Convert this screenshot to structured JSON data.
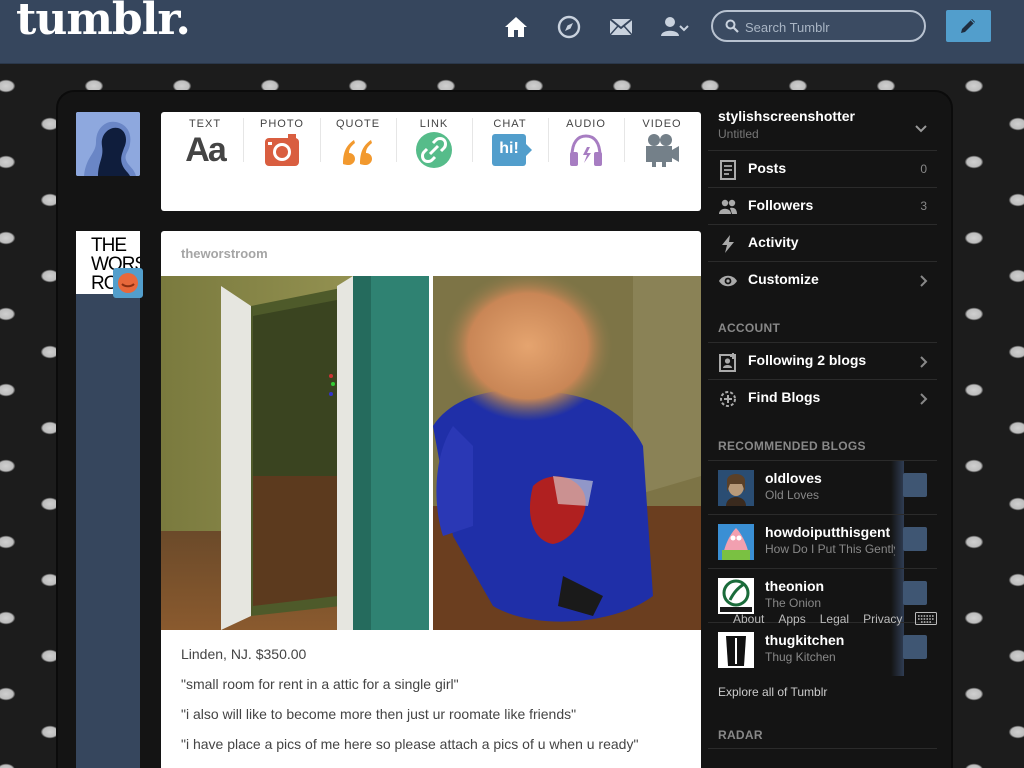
{
  "header": {
    "logo": "tumblr.",
    "nav_icons": [
      "home-icon",
      "explore-compass-icon",
      "inbox-mail-icon",
      "account-person-icon"
    ],
    "search_placeholder": "Search Tumblr",
    "compose_icon": "pencil-icon",
    "colors": {
      "bar": "#36465d",
      "accent": "#529ecc"
    }
  },
  "post_types": [
    {
      "label": "TEXT",
      "icon": "text-aa-icon",
      "glyph": "Aa",
      "color": "#444444"
    },
    {
      "label": "PHOTO",
      "icon": "camera-icon",
      "color": "#d95e40"
    },
    {
      "label": "QUOTE",
      "icon": "quote-icon",
      "color": "#f2992e"
    },
    {
      "label": "LINK",
      "icon": "link-icon",
      "color": "#56bc8a"
    },
    {
      "label": "CHAT",
      "icon": "chat-bubble-icon",
      "glyph": "hi!",
      "color": "#529ecc"
    },
    {
      "label": "AUDIO",
      "icon": "headphones-icon",
      "color": "#a77dc2"
    },
    {
      "label": "VIDEO",
      "icon": "video-camera-icon",
      "color": "#748089"
    }
  ],
  "avatar_worstroom_text": [
    "THE",
    "WORST",
    "ROO"
  ],
  "post": {
    "author": "theworstroom",
    "caption": [
      "Linden, NJ. $350.00",
      "\"small room for rent in a attic for a single girl\"",
      "\"i also will like to become more then just ur roomate like friends\"",
      "\"i have place a pics of me here so please attach a pics of u when u ready\""
    ]
  },
  "sidebar": {
    "blog_name": "stylishscreenshotter",
    "blog_title": "Untitled",
    "menu": [
      {
        "label": "Posts",
        "count": "0",
        "icon": "posts-icon"
      },
      {
        "label": "Followers",
        "count": "3",
        "icon": "followers-icon"
      },
      {
        "label": "Activity",
        "count": "",
        "icon": "lightning-icon"
      },
      {
        "label": "Customize",
        "count": "",
        "icon": "eye-icon"
      }
    ],
    "account_heading": "ACCOUNT",
    "account_items": [
      {
        "label": "Following 2 blogs",
        "icon": "following-icon"
      },
      {
        "label": "Find Blogs",
        "icon": "find-blogs-icon"
      }
    ],
    "recommended_heading": "RECOMMENDED BLOGS",
    "recommended": [
      {
        "name": "oldloves",
        "title": "Old Loves",
        "avatar": "oldloves-avatar"
      },
      {
        "name": "howdoiputthisgent",
        "title": "How Do I Put This Gently",
        "avatar": "patrick-avatar"
      },
      {
        "name": "theonion",
        "title": "The Onion",
        "avatar": "onion-avatar"
      },
      {
        "name": "thugkitchen",
        "title": "Thug Kitchen",
        "avatar": "thugkitchen-avatar"
      }
    ],
    "footer_links": [
      "About",
      "Apps",
      "Legal",
      "Privacy"
    ],
    "explore": "Explore all of Tumblr",
    "radar_heading": "RADAR"
  }
}
